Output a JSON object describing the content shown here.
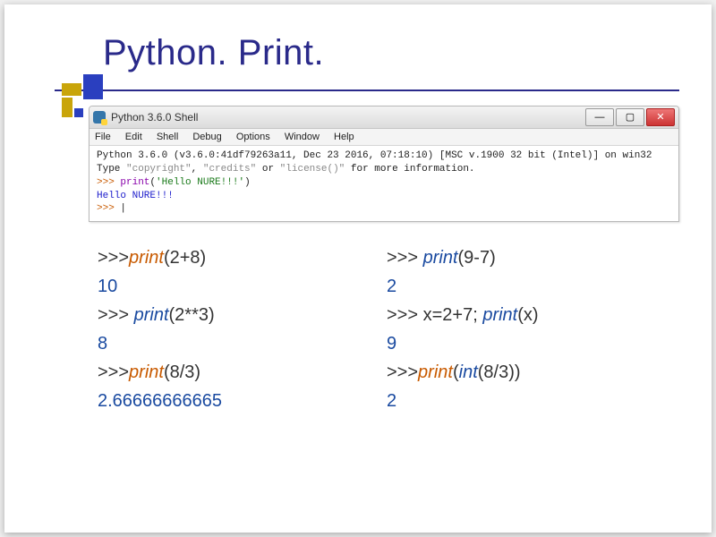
{
  "slide": {
    "title": "Python. Print."
  },
  "shell": {
    "window_title": "Python 3.6.0 Shell",
    "menu": [
      "File",
      "Edit",
      "Shell",
      "Debug",
      "Options",
      "Window",
      "Help"
    ],
    "version_line": "Python 3.6.0 (v3.6.0:41df79263a11, Dec 23 2016, 07:18:10) [MSC v.1900 32 bit (Intel)] on win32",
    "hint_line_prefix": "Type ",
    "hint_q1": "\"copyright\"",
    "hint_comma1": ", ",
    "hint_q2": "\"credits\"",
    "hint_or": " or ",
    "hint_q3": "\"license()\"",
    "hint_suffix": " for more information.",
    "prompt": ">>> ",
    "kw_print": "print",
    "lparen": "(",
    "rparen": ")",
    "str_hello": "'Hello NURE!!!'",
    "output_hello": "Hello NURE!!!",
    "prompt2": ">>>",
    "cursor": "|"
  },
  "examples": {
    "left": {
      "l1_prompt": ">>>",
      "l1_kw": "print",
      "l1_args": "(2+8)",
      "l1_out": "10",
      "l2_prompt": ">>> ",
      "l2_kw": "print",
      "l2_args": "(2**3)",
      "l2_out": "8",
      "l3_prompt": ">>>",
      "l3_kw": "print",
      "l3_args": "(8/3)",
      "l3_out": "2.66666666665"
    },
    "right": {
      "r1_prompt": ">>> ",
      "r1_kw": "print",
      "r1_args": "(9-7)",
      "r1_out": "2",
      "r2_prompt": " >>> ",
      "r2_pre": "x=2+7; ",
      "r2_kw": "print",
      "r2_args": "(x)",
      "r2_out": "9",
      "r3_prompt": ">>>",
      "r3_kw": "print",
      "r3_lparen": "(",
      "r3_kw2": "int",
      "r3_args2": "(8/3))",
      "r3_out": "2"
    }
  },
  "win_buttons": {
    "min": "—",
    "max": "▢",
    "close": "✕"
  }
}
